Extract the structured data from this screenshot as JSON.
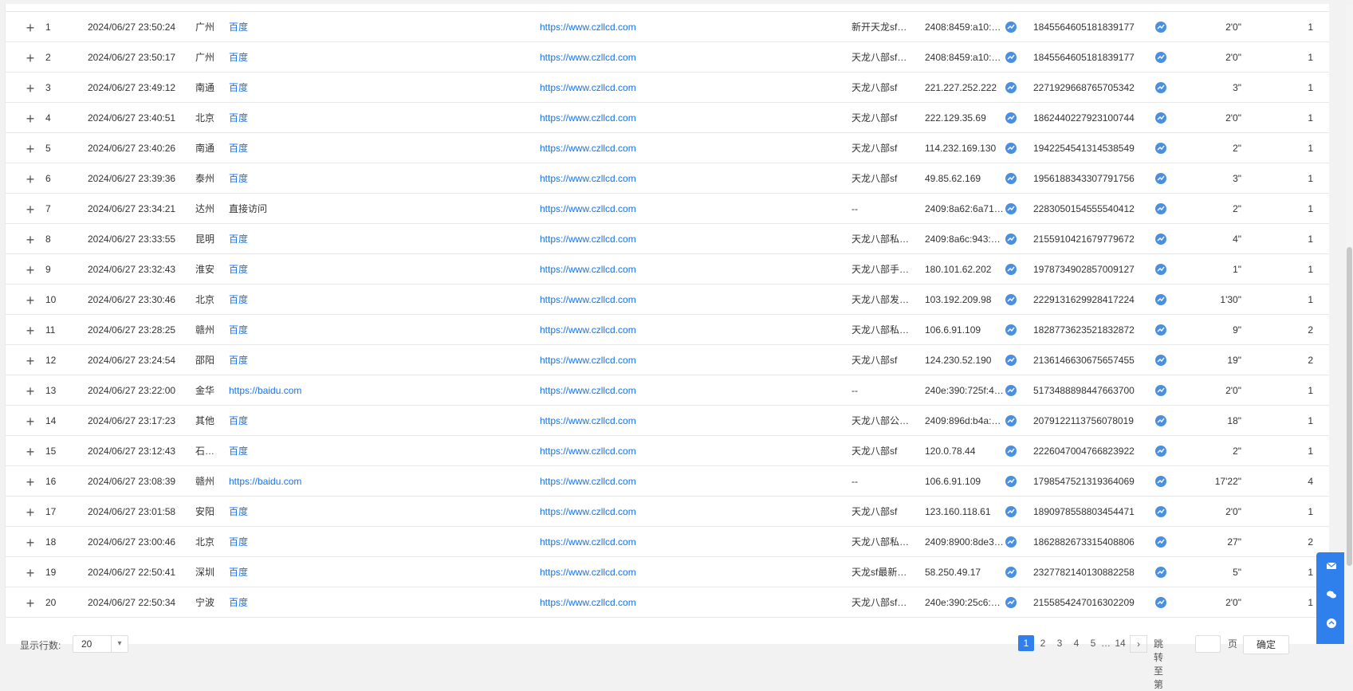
{
  "rows": [
    {
      "num": "1",
      "time": "2024/06/27 23:50:24",
      "city": "广州",
      "source": "百度",
      "landing": "https://www.czllcd.com",
      "keyword": "新开天龙sf…",
      "ip": "2408:8459:a10:…",
      "visitor": "1845564605181839177",
      "duration": "2'0\"",
      "pv": "1"
    },
    {
      "num": "2",
      "time": "2024/06/27 23:50:17",
      "city": "广州",
      "source": "百度",
      "landing": "https://www.czllcd.com",
      "keyword": "天龙八部sf…",
      "ip": "2408:8459:a10:…",
      "visitor": "1845564605181839177",
      "duration": "2'0\"",
      "pv": "1"
    },
    {
      "num": "3",
      "time": "2024/06/27 23:49:12",
      "city": "南通",
      "source": "百度",
      "landing": "https://www.czllcd.com",
      "keyword": "天龙八部sf",
      "ip": "221.227.252.222",
      "visitor": "2271929668765705342",
      "duration": "3\"",
      "pv": "1"
    },
    {
      "num": "4",
      "time": "2024/06/27 23:40:51",
      "city": "北京",
      "source": "百度",
      "landing": "https://www.czllcd.com",
      "keyword": "天龙八部sf",
      "ip": "222.129.35.69",
      "visitor": "1862440227923100744",
      "duration": "2'0\"",
      "pv": "1"
    },
    {
      "num": "5",
      "time": "2024/06/27 23:40:26",
      "city": "南通",
      "source": "百度",
      "landing": "https://www.czllcd.com",
      "keyword": "天龙八部sf",
      "ip": "114.232.169.130",
      "visitor": "1942254541314538549",
      "duration": "2\"",
      "pv": "1"
    },
    {
      "num": "6",
      "time": "2024/06/27 23:39:36",
      "city": "泰州",
      "source": "百度",
      "landing": "https://www.czllcd.com",
      "keyword": "天龙八部sf",
      "ip": "49.85.62.169",
      "visitor": "1956188343307791756",
      "duration": "3\"",
      "pv": "1"
    },
    {
      "num": "7",
      "time": "2024/06/27 23:34:21",
      "city": "达州",
      "source": "直接访问",
      "landing": "https://www.czllcd.com",
      "keyword": "--",
      "ip": "2409:8a62:6a71…",
      "visitor": "2283050154555540412",
      "duration": "2\"",
      "pv": "1"
    },
    {
      "num": "8",
      "time": "2024/06/27 23:33:55",
      "city": "昆明",
      "source": "百度",
      "landing": "https://www.czllcd.com",
      "keyword": "天龙八部私…",
      "ip": "2409:8a6c:943:…",
      "visitor": "2155910421679779672",
      "duration": "4\"",
      "pv": "1"
    },
    {
      "num": "9",
      "time": "2024/06/27 23:32:43",
      "city": "淮安",
      "source": "百度",
      "landing": "https://www.czllcd.com",
      "keyword": "天龙八部手…",
      "ip": "180.101.62.202",
      "visitor": "1978734902857009127",
      "duration": "1\"",
      "pv": "1"
    },
    {
      "num": "10",
      "time": "2024/06/27 23:30:46",
      "city": "北京",
      "source": "百度",
      "landing": "https://www.czllcd.com",
      "keyword": "天龙八部发…",
      "ip": "103.192.209.98",
      "visitor": "2229131629928417224",
      "duration": "1'30\"",
      "pv": "1"
    },
    {
      "num": "11",
      "time": "2024/06/27 23:28:25",
      "city": "赣州",
      "source": "百度",
      "landing": "https://www.czllcd.com",
      "keyword": "天龙八部私…",
      "ip": "106.6.91.109",
      "visitor": "1828773623521832872",
      "duration": "9\"",
      "pv": "2"
    },
    {
      "num": "12",
      "time": "2024/06/27 23:24:54",
      "city": "邵阳",
      "source": "百度",
      "landing": "https://www.czllcd.com",
      "keyword": "天龙八部sf",
      "ip": "124.230.52.190",
      "visitor": "2136146630675657455",
      "duration": "19\"",
      "pv": "2"
    },
    {
      "num": "13",
      "time": "2024/06/27 23:22:00",
      "city": "金华",
      "source": "https://baidu.com",
      "landing": "https://www.czllcd.com",
      "keyword": "--",
      "ip": "240e:390:725f:4…",
      "visitor": "5173488898447663700",
      "duration": "2'0\"",
      "pv": "1"
    },
    {
      "num": "14",
      "time": "2024/06/27 23:17:23",
      "city": "其他",
      "source": "百度",
      "landing": "https://www.czllcd.com",
      "keyword": "天龙八部公…",
      "ip": "2409:896d:b4a:…",
      "visitor": "2079122113756078019",
      "duration": "18\"",
      "pv": "1"
    },
    {
      "num": "15",
      "time": "2024/06/27 23:12:43",
      "city": "石…",
      "source": "百度",
      "landing": "https://www.czllcd.com",
      "keyword": "天龙八部sf",
      "ip": "120.0.78.44",
      "visitor": "2226047004766823922",
      "duration": "2\"",
      "pv": "1"
    },
    {
      "num": "16",
      "time": "2024/06/27 23:08:39",
      "city": "赣州",
      "source": "https://baidu.com",
      "landing": "https://www.czllcd.com",
      "keyword": "--",
      "ip": "106.6.91.109",
      "visitor": "1798547521319364069",
      "duration": "17'22\"",
      "pv": "4"
    },
    {
      "num": "17",
      "time": "2024/06/27 23:01:58",
      "city": "安阳",
      "source": "百度",
      "landing": "https://www.czllcd.com",
      "keyword": "天龙八部sf",
      "ip": "123.160.118.61",
      "visitor": "1890978558803454471",
      "duration": "2'0\"",
      "pv": "1"
    },
    {
      "num": "18",
      "time": "2024/06/27 23:00:46",
      "city": "北京",
      "source": "百度",
      "landing": "https://www.czllcd.com",
      "keyword": "天龙八部私…",
      "ip": "2409:8900:8de3…",
      "visitor": "1862882673315408806",
      "duration": "27\"",
      "pv": "2"
    },
    {
      "num": "19",
      "time": "2024/06/27 22:50:41",
      "city": "深圳",
      "source": "百度",
      "landing": "https://www.czllcd.com",
      "keyword": "天龙sf最新…",
      "ip": "58.250.49.17",
      "visitor": "2327782140130882258",
      "duration": "5\"",
      "pv": "1"
    },
    {
      "num": "20",
      "time": "2024/06/27 22:50:34",
      "city": "宁波",
      "source": "百度",
      "landing": "https://www.czllcd.com",
      "keyword": "天龙八部sf…",
      "ip": "240e:390:25c6:…",
      "visitor": "2155854247016302209",
      "duration": "2'0\"",
      "pv": "1"
    }
  ],
  "footer": {
    "rows_label": "显示行数:",
    "rows_value": "20",
    "pages": [
      "1",
      "2",
      "3",
      "4",
      "5",
      "…",
      "14"
    ],
    "jump_label": "跳转至第",
    "jump_unit": "页",
    "confirm": "确定"
  },
  "icons": {
    "expand": "plus-icon",
    "trend": "trend-icon"
  },
  "colors": {
    "accent": "#2f80ed",
    "link": "#1a73e8"
  }
}
